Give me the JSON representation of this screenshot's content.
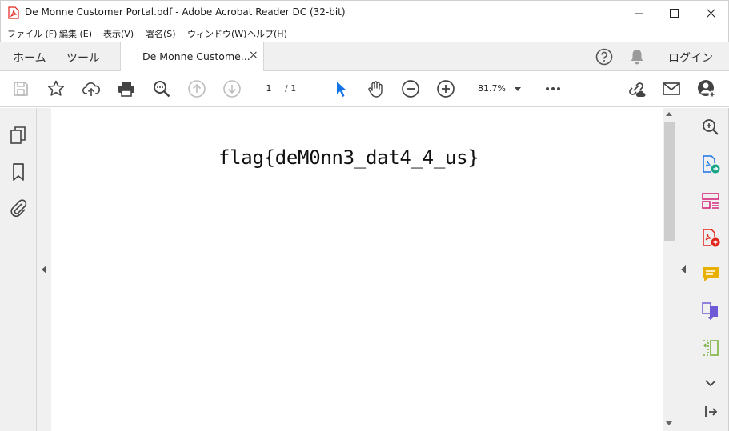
{
  "window": {
    "title": "De Monne Customer Portal.pdf - Adobe Acrobat Reader DC (32-bit)"
  },
  "menu": {
    "items": [
      {
        "label": "ファイル (F)"
      },
      {
        "label": "編集 (E)"
      },
      {
        "label": "表示(V)"
      },
      {
        "label": "署名(S)"
      },
      {
        "label": "ウィンドウ(W)"
      },
      {
        "label": "ヘルプ(H)"
      }
    ]
  },
  "tabs": {
    "home": "ホーム",
    "tools": "ツール",
    "document": "De Monne Custome...",
    "close": "×",
    "login": "ログイン"
  },
  "toolbar": {
    "current_page": "1",
    "page_total": "/ 1",
    "zoom": "81.7%"
  },
  "document": {
    "content": "flag{deM0nn3_dat4_4_us}"
  },
  "colors": {
    "accent_blue": "#1473e6",
    "pdf_red": "#e2231a",
    "tool_green": "#17a589",
    "tool_pink": "#d6287d",
    "tool_yellow": "#e8b003",
    "tool_purple": "#6f5ad6",
    "tool_lime": "#7cb342"
  }
}
